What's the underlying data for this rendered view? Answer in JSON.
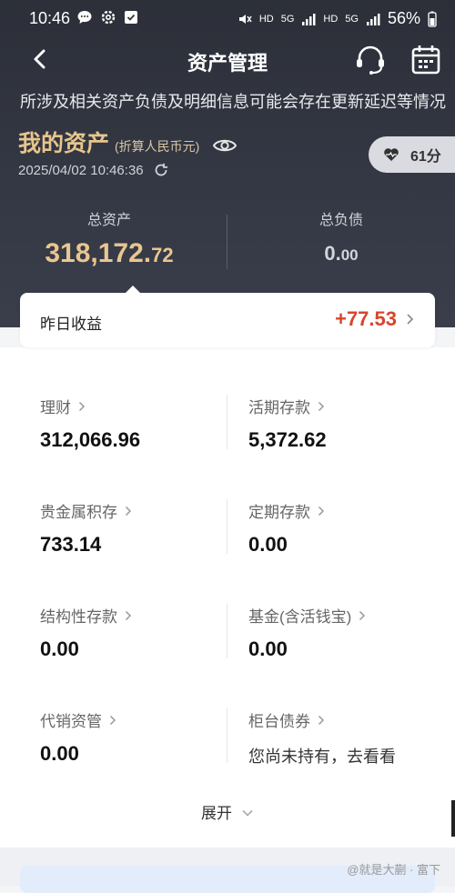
{
  "status_bar": {
    "time": "10:46",
    "battery": "56%",
    "net1": "HD",
    "net2": "5G",
    "net3": "HD",
    "net4": "5G"
  },
  "header": {
    "title": "资产管理"
  },
  "notice": "所涉及相关资产负债及明细信息可能会存在更新延迟等情况",
  "assets": {
    "title": "我的资产",
    "currency_note": "(折算人民币元)",
    "updated_at": "2025/04/02 10:46:36",
    "score": "61分",
    "total_label": "总资产",
    "total_main": "318,172.",
    "total_decimal": "72",
    "debt_label": "总负债",
    "debt_main": "0.",
    "debt_decimal": "00"
  },
  "yesterday": {
    "label": "昨日收益",
    "value": "+77.53"
  },
  "items": [
    {
      "label": "理财",
      "value": "312,066.96"
    },
    {
      "label": "活期存款",
      "value": "5,372.62"
    },
    {
      "label": "贵金属积存",
      "value": "733.14"
    },
    {
      "label": "定期存款",
      "value": "0.00"
    },
    {
      "label": "结构性存款",
      "value": "0.00"
    },
    {
      "label": "基金(含活钱宝)",
      "value": "0.00"
    },
    {
      "label": "代销资管",
      "value": "0.00"
    },
    {
      "label": "柜台债券",
      "value": "您尚未持有，去看看"
    }
  ],
  "expand_label": "展开",
  "watermark": "@就是大蒯 · 富下",
  "colors": {
    "accent_gold": "#e9c690",
    "gain_red": "#d8452d",
    "hero_bg": "#2c2f38"
  }
}
